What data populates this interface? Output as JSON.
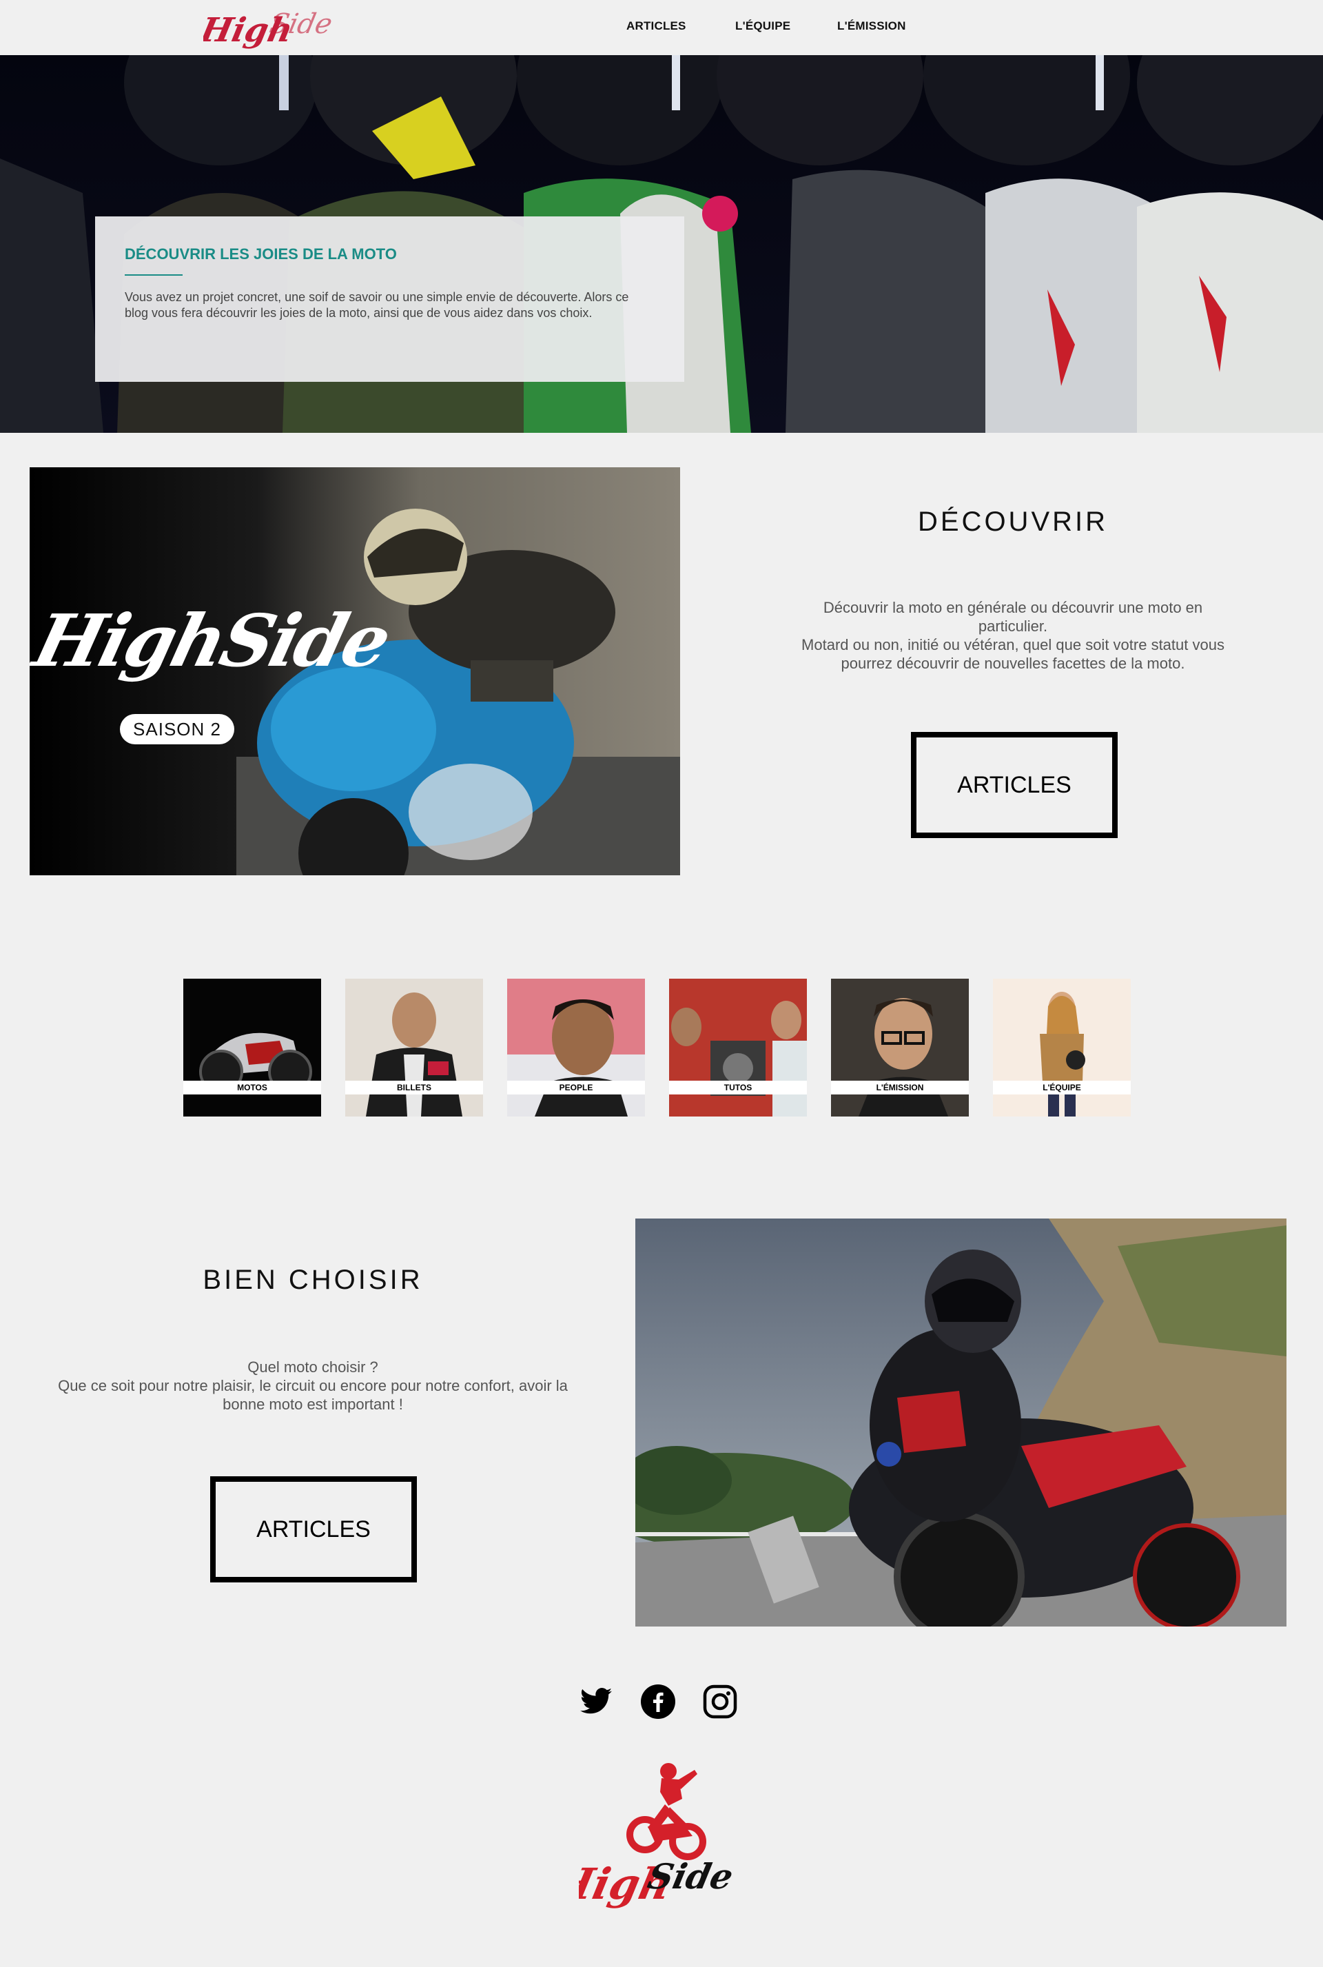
{
  "header": {
    "logo_text": "HighSide",
    "nav": [
      {
        "label": "ARTICLES"
      },
      {
        "label": "L'ÉQUIPE"
      },
      {
        "label": "L'ÉMISSION"
      }
    ]
  },
  "hero": {
    "title": "DÉCOUVRIR LES JOIES DE LA MOTO",
    "text": "Vous avez un projet concret, une soif de savoir ou une simple envie de découverte. Alors ce blog vous fera découvrir les joies de la moto, ainsi que de vous aidez dans vos choix."
  },
  "discover": {
    "image_brand": "HighSide",
    "image_badge": "SAISON 2",
    "title": "DÉCOUVRIR",
    "text_lines": [
      "Découvrir la moto en générale ou découvrir une moto en",
      "particulier.",
      "Motard ou non, initié ou vétéran, quel que soit votre statut vous",
      "pourrez découvrir de nouvelles facettes de la moto."
    ],
    "button": "ARTICLES"
  },
  "categories": [
    {
      "label": "MOTOS"
    },
    {
      "label": "BILLETS"
    },
    {
      "label": "PEOPLE"
    },
    {
      "label": "TUTOS"
    },
    {
      "label": "L'ÉMISSION"
    },
    {
      "label": "L'ÉQUIPE"
    }
  ],
  "choose": {
    "title": "BIEN CHOISIR",
    "text_lines": [
      "Quel moto choisir ?",
      "Que ce soit pour notre plaisir, le circuit ou encore pour notre confort, avoir la",
      "bonne moto est important !"
    ],
    "button": "ARTICLES"
  },
  "footer": {
    "social": [
      {
        "icon": "twitter-icon"
      },
      {
        "icon": "facebook-icon"
      },
      {
        "icon": "instagram-icon"
      }
    ],
    "logo_text": "HighSide"
  },
  "colors": {
    "accent_teal": "#1a8c86",
    "brand_red": "#d4202a",
    "background": "#f0f0f0"
  }
}
